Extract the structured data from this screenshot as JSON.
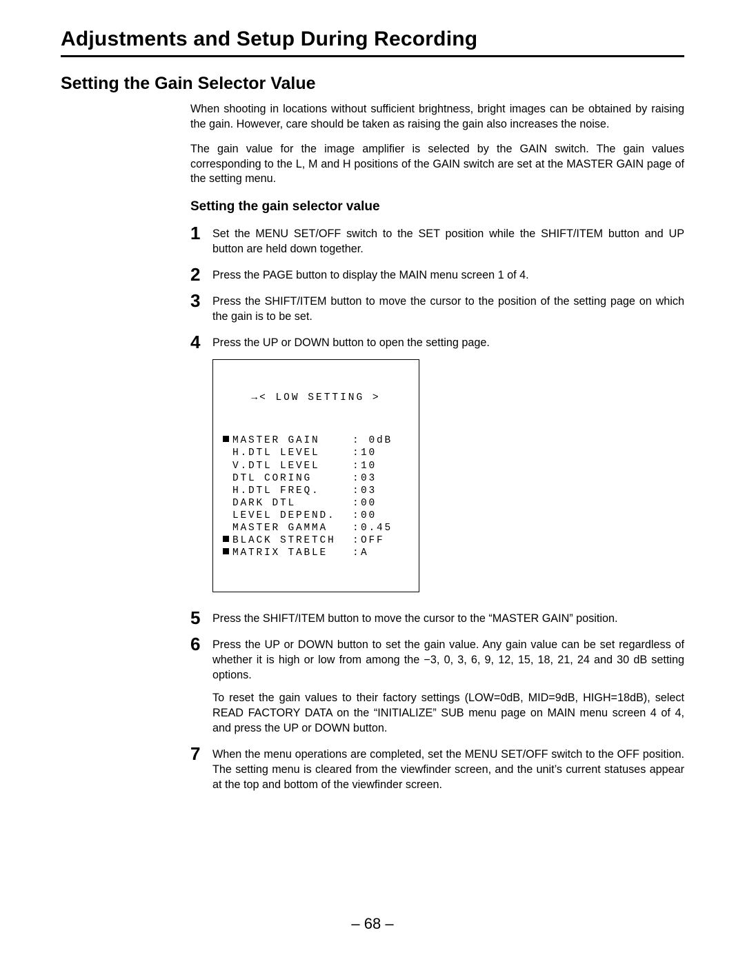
{
  "title": "Adjustments and Setup During Recording",
  "section_title": "Setting the Gain Selector Value",
  "intro": [
    "When shooting in locations without sufficient brightness, bright images can be obtained by raising the gain. However, care should be taken as raising the gain also increases the noise.",
    "The gain value for the image amplifier is selected by the GAIN switch. The gain values corresponding to the L, M and H positions of the GAIN switch are set at the MASTER GAIN page of the setting menu."
  ],
  "procedure_title": "Setting the gain selector value",
  "steps": [
    {
      "n": "1",
      "text": "Set the MENU SET/OFF switch to the SET position while the SHIFT/ITEM button and UP button are held down together."
    },
    {
      "n": "2",
      "text": "Press the PAGE button to display the MAIN menu screen 1 of 4."
    },
    {
      "n": "3",
      "text": "Press the SHIFT/ITEM button to move the cursor to the position of the setting page on which the gain is to be set."
    },
    {
      "n": "4",
      "text": "Press the UP or DOWN button to open the setting page."
    },
    {
      "n": "5",
      "text": "Press the SHIFT/ITEM button to move the cursor to the “MASTER GAIN” position."
    },
    {
      "n": "6",
      "text": "Press the UP or DOWN button to set the gain value.\nAny gain value can be set regardless of whether it is high or low from among the −3, 0, 3, 6, 9, 12, 15, 18, 21, 24 and 30 dB setting options.",
      "text2": "To reset the gain values to their factory settings (LOW=0dB, MID=9dB, HIGH=18dB), select READ FACTORY DATA on the “INITIALIZE” SUB menu page on MAIN menu screen 4 of 4, and press the UP or DOWN button."
    },
    {
      "n": "7",
      "text": "When the menu operations are completed, set the MENU SET/OFF switch to the OFF position.\nThe setting menu is cleared from the viewfinder screen, and the unit’s current statuses appear at the top and bottom of the viewfinder screen."
    }
  ],
  "menu": {
    "header": "→< LOW SETTING >",
    "rows": [
      {
        "marker": true,
        "label": "MASTER GAIN",
        "value": " 0dB"
      },
      {
        "marker": false,
        "label": "H.DTL LEVEL",
        "value": "10"
      },
      {
        "marker": false,
        "label": "V.DTL LEVEL",
        "value": "10"
      },
      {
        "marker": false,
        "label": "DTL CORING",
        "value": "03"
      },
      {
        "marker": false,
        "label": "H.DTL FREQ.",
        "value": "03"
      },
      {
        "marker": false,
        "label": "DARK DTL",
        "value": "00"
      },
      {
        "marker": false,
        "label": "LEVEL DEPEND.",
        "value": "00"
      },
      {
        "marker": false,
        "label": "MASTER GAMMA",
        "value": "0.45"
      },
      {
        "marker": true,
        "label": "BLACK STRETCH",
        "value": "OFF"
      },
      {
        "marker": true,
        "label": "MATRIX TABLE",
        "value": "A"
      }
    ]
  },
  "page_number": "– 68 –"
}
